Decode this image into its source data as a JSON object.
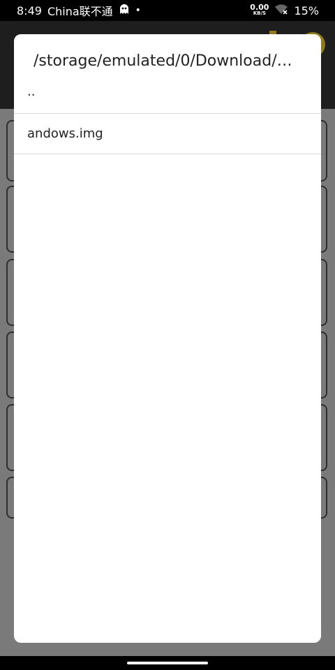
{
  "status_bar": {
    "time": "8:49",
    "carrier": "China联不通",
    "ghost_icon": "ghost-icon",
    "dot": "•",
    "net_speed_value": "0.00",
    "net_speed_unit": "KB/S",
    "wifi_icon": "wifi-off-icon",
    "battery": "15%"
  },
  "dialog": {
    "title": "/storage/emulated/0/Download/…",
    "items": [
      {
        "label": ".."
      },
      {
        "label": "andows.img"
      }
    ]
  },
  "colors": {
    "dim_background": "#7a7a7a",
    "dialog_bg": "#ffffff",
    "accent_dimmed": "#8f7a1b"
  }
}
